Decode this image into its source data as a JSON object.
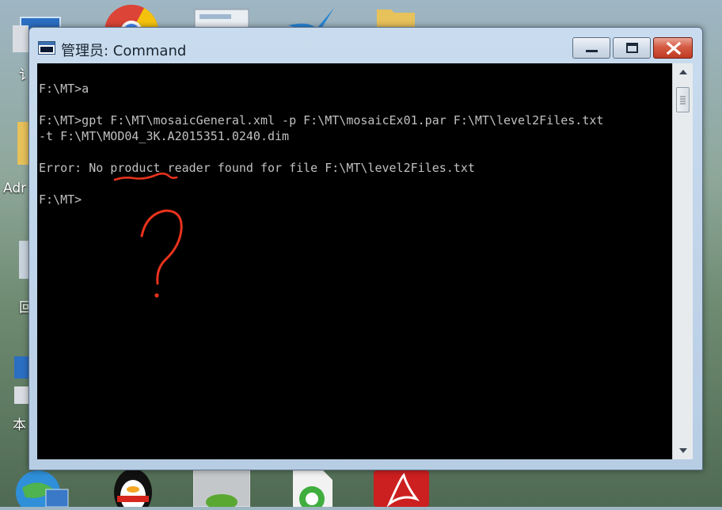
{
  "desktop": {
    "labels": [
      "Adr",
      "回",
      "本"
    ]
  },
  "window": {
    "title": "管理员: Command",
    "controls": {
      "minimize": "minimize-icon",
      "maximize": "maximize-icon",
      "close": "close-icon"
    }
  },
  "console": {
    "lines": [
      "F:\\MT>a",
      "F:\\MT>gpt F:\\MT\\mosaicGeneral.xml -p F:\\MT\\mosaicEx01.par F:\\MT\\level2Files.txt",
      "-t F:\\MT\\MOD04_3K.A2015351.0240.dim",
      "Error: No product reader found for file F:\\MT\\level2Files.txt",
      "F:\\MT>"
    ]
  },
  "annotation": {
    "color": "#e8321c",
    "symbol": "question-mark"
  },
  "colors": {
    "console_bg": "#000000",
    "console_fg": "#c0c0c0",
    "close_button": "#c9432c"
  }
}
